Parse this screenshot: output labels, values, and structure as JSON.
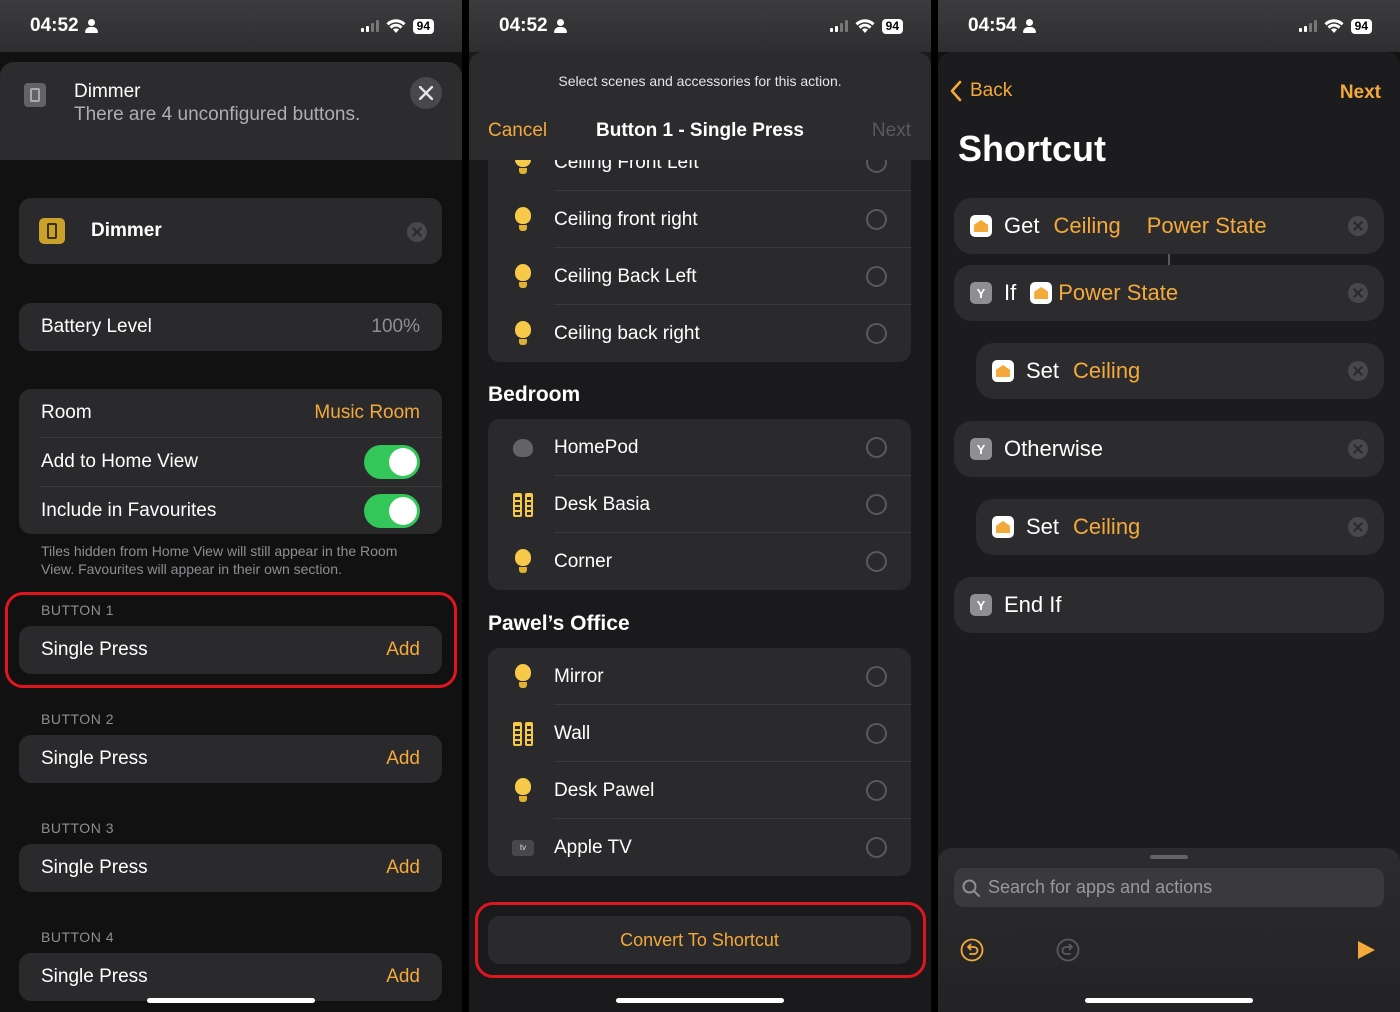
{
  "status": {
    "p1_time": "04:52",
    "p2_time": "04:52",
    "p3_time": "04:54",
    "battery": "94"
  },
  "panel1": {
    "header_title": "Dimmer",
    "header_subtitle": "There are 4 unconfigured buttons.",
    "device_name": "Dimmer",
    "battery_label": "Battery Level",
    "battery_value": "100%",
    "room_label": "Room",
    "room_value": "Music Room",
    "home_view_label": "Add to Home View",
    "favourites_label": "Include in Favourites",
    "footnote": "Tiles hidden from Home View will still appear in the Room View. Favourites will appear in their own section.",
    "buttons": [
      {
        "section": "BUTTON 1",
        "label": "Single Press",
        "action": "Add"
      },
      {
        "section": "BUTTON 2",
        "label": "Single Press",
        "action": "Add"
      },
      {
        "section": "BUTTON 3",
        "label": "Single Press",
        "action": "Add"
      },
      {
        "section": "BUTTON 4",
        "label": "Single Press",
        "action": "Add"
      }
    ]
  },
  "panel2": {
    "prompt": "Select scenes and accessories for this action.",
    "cancel": "Cancel",
    "title": "Button 1 - Single Press",
    "next": "Next",
    "group0": {
      "items": [
        "Ceiling Front Left",
        "Ceiling front right",
        "Ceiling Back Left",
        "Ceiling back right"
      ]
    },
    "group1": {
      "name": "Bedroom",
      "items": [
        "HomePod",
        "Desk Basia",
        "Corner"
      ]
    },
    "group2": {
      "name": "Pawel’s Office",
      "items": [
        "Mirror",
        "Wall",
        "Desk Pawel",
        "Apple TV"
      ]
    },
    "convert": "Convert To Shortcut",
    "appletv_badge": "tv"
  },
  "panel3": {
    "back": "Back",
    "next": "Next",
    "title": "Shortcut",
    "actions": [
      {
        "verb": "Get",
        "p1": "Ceiling",
        "p2": "Power State"
      },
      {
        "verb": "If",
        "p1": "Power State"
      },
      {
        "verb": "Set",
        "p1": "Ceiling"
      },
      {
        "verb": "Otherwise"
      },
      {
        "verb": "Set",
        "p1": "Ceiling"
      },
      {
        "verb": "End If"
      }
    ],
    "search_placeholder": "Search for apps and actions"
  },
  "colors": {
    "accent": "#f4a93b",
    "highlight": "#e0161e",
    "toggle_on": "#33c759"
  }
}
